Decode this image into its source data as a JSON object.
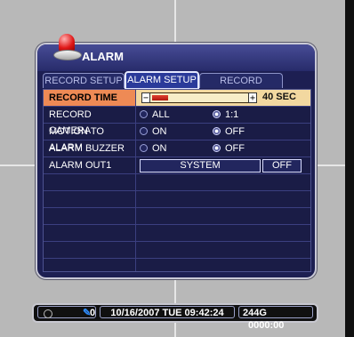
{
  "window": {
    "title": "ALARM",
    "tabs": [
      {
        "label": "RECORD SETUP",
        "active": false
      },
      {
        "label": "ALARM SETUP",
        "active": true
      },
      {
        "label": "RECORD ENABLE",
        "active": false
      }
    ]
  },
  "settings": {
    "record_time": {
      "label": "RECORD TIME",
      "value": "40 SEC",
      "slider_level_fraction": 0.17
    },
    "record_camera": {
      "label": "RECORD CAMERA",
      "options": [
        "ALL",
        "1:1"
      ],
      "selected": "1:1"
    },
    "motion_to_alarm": {
      "label": "MOTION TO ALARM",
      "options": [
        "ON",
        "OFF"
      ],
      "selected": "OFF"
    },
    "alarm_buzzer": {
      "label": "ALARM BUZZER",
      "options": [
        "ON",
        "OFF"
      ],
      "selected": "OFF"
    },
    "alarm_out1": {
      "label": "ALARM OUT1",
      "mode": "SYSTEM",
      "state": "OFF"
    }
  },
  "statusbar": {
    "channel_count": "0",
    "datetime": "10/16/2007 TUE 09:42:24",
    "storage": "244G",
    "counter": "0000:00"
  },
  "colors": {
    "background": "#b8b8b8",
    "panel": "#1d1f52",
    "selected_label": "#ee8a55",
    "selected_row": "#f2d8a0",
    "slider_fill": "#d02818"
  }
}
